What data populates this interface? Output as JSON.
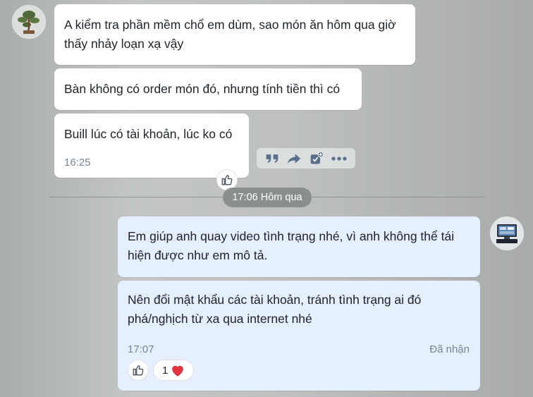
{
  "messages": {
    "m1": "A kiểm tra phần mềm chổ em dùm, sao món ăn hôm qua giờ thấy nhảy loạn xạ vậy",
    "m2": "Bàn không có order món đó, nhưng tính tiền thì có",
    "m3": "Buill lúc có tài khoản, lúc ko có",
    "m3_time": "16:25",
    "m4": "Em giúp anh quay video tình trạng nhé, vì anh không thể tái hiện được như em mô tả.",
    "m5": "Nên đổi mật khẩu các tài khoản, tránh tình trạng ai đó phá/nghịch từ xa qua internet nhé",
    "m5_time": "17:07",
    "m5_status": "Đã nhận",
    "m5_reaction_count": "1"
  },
  "divider": {
    "label": "17:06 Hôm qua"
  },
  "icons": {
    "like": "thumbs-up-icon",
    "quote": "quote-icon",
    "forward": "share-icon",
    "task": "add-task-icon",
    "more": "more-icon",
    "reaction": "heart-icon"
  },
  "colors": {
    "incoming_bubble": "#ffffff",
    "outgoing_bubble": "#e5efff",
    "action_icons": "#5a6f8a",
    "heart": "#e5323e"
  }
}
